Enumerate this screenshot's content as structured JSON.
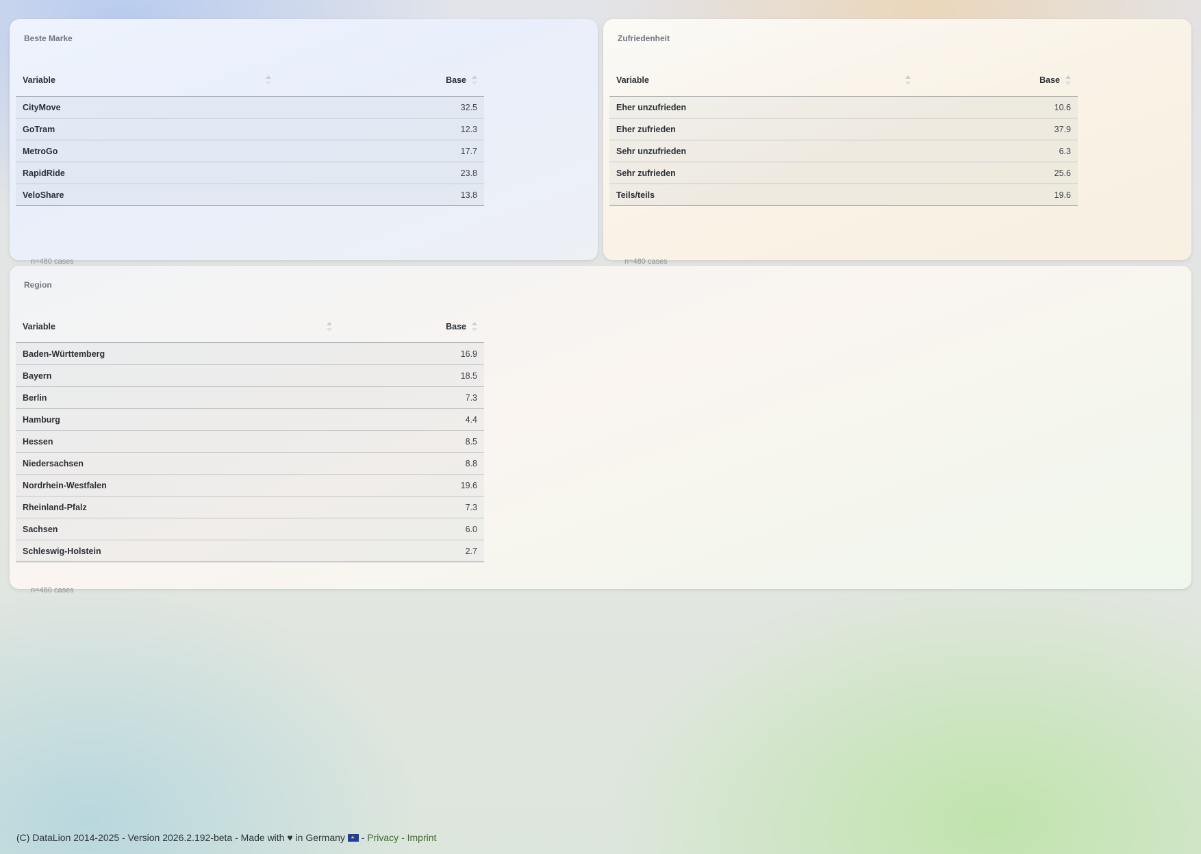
{
  "panels": {
    "brand": {
      "title": "Beste Marke",
      "columns": [
        "Variable",
        "Base"
      ],
      "rows": [
        {
          "label": "CityMove",
          "value": "32.5"
        },
        {
          "label": "GoTram",
          "value": "12.3"
        },
        {
          "label": "MetroGo",
          "value": "17.7"
        },
        {
          "label": "RapidRide",
          "value": "23.8"
        },
        {
          "label": "VeloShare",
          "value": "13.8"
        }
      ],
      "cases": "n=480 cases"
    },
    "satisfaction": {
      "title": "Zufriedenheit",
      "columns": [
        "Variable",
        "Base"
      ],
      "rows": [
        {
          "label": "Eher unzufrieden",
          "value": "10.6"
        },
        {
          "label": "Eher zufrieden",
          "value": "37.9"
        },
        {
          "label": "Sehr unzufrieden",
          "value": "6.3"
        },
        {
          "label": "Sehr zufrieden",
          "value": "25.6"
        },
        {
          "label": "Teils/teils",
          "value": "19.6"
        }
      ],
      "cases": "n=480 cases"
    },
    "region": {
      "title": "Region",
      "columns": [
        "Variable",
        "Base"
      ],
      "rows": [
        {
          "label": "Baden-Württemberg",
          "value": "16.9"
        },
        {
          "label": "Bayern",
          "value": "18.5"
        },
        {
          "label": "Berlin",
          "value": "7.3"
        },
        {
          "label": "Hamburg",
          "value": "4.4"
        },
        {
          "label": "Hessen",
          "value": "8.5"
        },
        {
          "label": "Niedersachsen",
          "value": "8.8"
        },
        {
          "label": "Nordrhein-Westfalen",
          "value": "19.6"
        },
        {
          "label": "Rheinland-Pfalz",
          "value": "7.3"
        },
        {
          "label": "Sachsen",
          "value": "6.0"
        },
        {
          "label": "Schleswig-Holstein",
          "value": "2.7"
        }
      ],
      "cases": "n=480 cases"
    }
  },
  "footer": {
    "text": "(C) DataLion 2014-2025 - Version 2026.2.192-beta - Made with",
    "heart": "♥",
    "in_germany": "in Germany",
    "flag_icon": "eu-flag-icon",
    "sep1": "-",
    "privacy": "Privacy",
    "sep2": "-",
    "imprint": "Imprint"
  }
}
